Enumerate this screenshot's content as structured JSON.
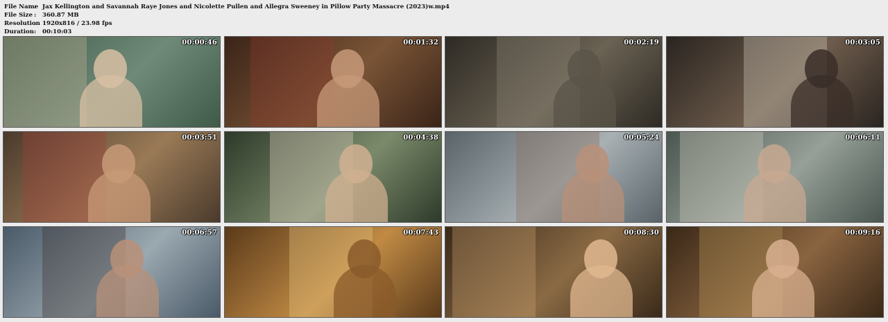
{
  "info": {
    "rows": [
      {
        "label": "File Name",
        "value": "Jax Kellington and Savannah Raye Jones and Nicolette Pullen and Allegra Sweeney in Pillow Party Massacre (2023)w.mp4"
      },
      {
        "label": "File Size",
        "value": "360.87 MB"
      },
      {
        "label": "Resolution",
        "value": "1920x816 / 23.98 fps"
      },
      {
        "label": "Duration",
        "value": "00:10:03"
      }
    ],
    "separator": ":"
  },
  "thumbnails": [
    {
      "timestamp": "00:00:46",
      "bg": [
        "#3f5a48",
        "#6f8a78"
      ],
      "accent": "#c9b49a",
      "figure": "#d8c0a3"
    },
    {
      "timestamp": "00:01:32",
      "bg": [
        "#3a2418",
        "#7a5436"
      ],
      "accent": "#8c3a2e",
      "figure": "#c79a7a"
    },
    {
      "timestamp": "00:02:19",
      "bg": [
        "#2e2a24",
        "#6a6253"
      ],
      "accent": "#8d8878",
      "figure": "#5a5448"
    },
    {
      "timestamp": "00:03:05",
      "bg": [
        "#2a2420",
        "#6e5c4c"
      ],
      "accent": "#d8d0c4",
      "figure": "#3a2e28"
    },
    {
      "timestamp": "00:03:51",
      "bg": [
        "#4a3a2c",
        "#9a7a56"
      ],
      "accent": "#a43e3a",
      "figure": "#c89a78"
    },
    {
      "timestamp": "00:04:38",
      "bg": [
        "#2e3a2a",
        "#7a8a6a"
      ],
      "accent": "#e8d8c8",
      "figure": "#d0b090"
    },
    {
      "timestamp": "00:05:24",
      "bg": [
        "#5a6468",
        "#a8b0b4"
      ],
      "accent": "#8a6a58",
      "figure": "#b89078"
    },
    {
      "timestamp": "00:06:11",
      "bg": [
        "#4a5650",
        "#96a098"
      ],
      "accent": "#d8d0c4",
      "figure": "#c8a890"
    },
    {
      "timestamp": "00:06:57",
      "bg": [
        "#4a5a68",
        "#9aa8b0"
      ],
      "accent": "#3a2e2a",
      "figure": "#b89078"
    },
    {
      "timestamp": "00:07:43",
      "bg": [
        "#5a3a1a",
        "#c08a44"
      ],
      "accent": "#e8c888",
      "figure": "#8a5a2a"
    },
    {
      "timestamp": "00:08:30",
      "bg": [
        "#3a2a1a",
        "#8a6a44"
      ],
      "accent": "#c8a070",
      "figure": "#e0b890"
    },
    {
      "timestamp": "00:09:16",
      "bg": [
        "#3a2818",
        "#8a6440"
      ],
      "accent": "#b8985a",
      "figure": "#d8b090"
    }
  ]
}
